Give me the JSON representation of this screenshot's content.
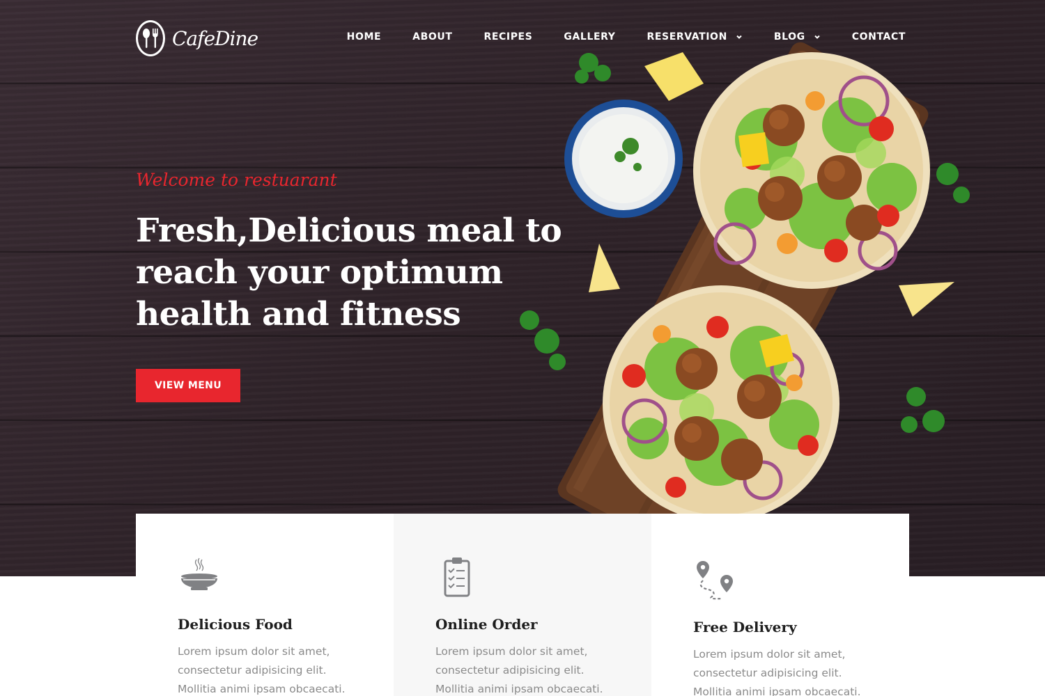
{
  "brand": {
    "name": "CafeDine"
  },
  "nav": {
    "items": [
      {
        "label": "HOME",
        "dropdown": false
      },
      {
        "label": "ABOUT",
        "dropdown": false
      },
      {
        "label": "RECIPES",
        "dropdown": false
      },
      {
        "label": "GALLERY",
        "dropdown": false
      },
      {
        "label": "RESERVATION",
        "dropdown": true
      },
      {
        "label": "BLOG",
        "dropdown": true
      },
      {
        "label": "CONTACT",
        "dropdown": false
      }
    ]
  },
  "hero": {
    "welcome": "Welcome to restuarant",
    "headline": "Fresh,Delicious meal to reach your optimum health and fitness",
    "cta_label": "VIEW MENU"
  },
  "features": [
    {
      "icon": "soup-bowl-icon",
      "title": "Delicious Food",
      "description": "Lorem ipsum dolor sit amet, consectetur adipisicing elit. Mollitia animi ipsam obcaecati."
    },
    {
      "icon": "clipboard-checklist-icon",
      "title": "Online Order",
      "description": "Lorem ipsum dolor sit amet, consectetur adipisicing elit. Mollitia animi ipsam obcaecati."
    },
    {
      "icon": "delivery-route-icon",
      "title": "Free Delivery",
      "description": "Lorem ipsum dolor sit amet, consectetur adipisicing elit. Mollitia animi ipsam obcaecati."
    }
  ],
  "colors": {
    "accent": "#e8262e",
    "hero_bg": "#2f2329",
    "text_dark": "#1e1e1e",
    "text_muted": "#8a8a8a",
    "icon_gray": "#808184"
  }
}
